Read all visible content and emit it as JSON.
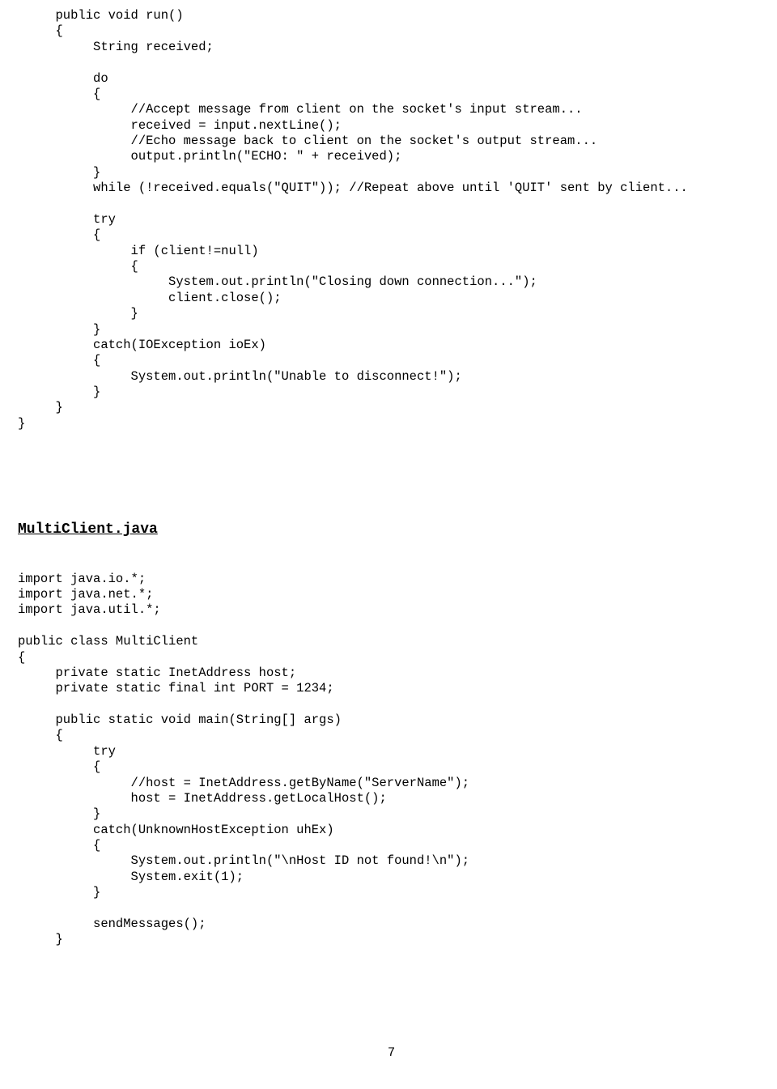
{
  "code_block_1": "     public void run()\n     {\n          String received;\n\n          do\n          {\n               //Accept message from client on the socket's input stream...\n               received = input.nextLine();\n               //Echo message back to client on the socket's output stream...\n               output.println(\"ECHO: \" + received);\n          }\n          while (!received.equals(\"QUIT\")); //Repeat above until 'QUIT' sent by client...\n\n          try\n          {\n               if (client!=null)\n               {\n                    System.out.println(\"Closing down connection...\");\n                    client.close();\n               }\n          }\n          catch(IOException ioEx)\n          {\n               System.out.println(\"Unable to disconnect!\");\n          }\n     }\n}",
  "heading_text": "MultiClient.java",
  "code_block_2": "import java.io.*;\nimport java.net.*;\nimport java.util.*;\n\npublic class MultiClient\n{\n     private static InetAddress host;\n     private static final int PORT = 1234;\n\n     public static void main(String[] args)\n     {\n          try\n          {\n               //host = InetAddress.getByName(\"ServerName\");\n               host = InetAddress.getLocalHost();\n          }\n          catch(UnknownHostException uhEx)\n          {\n               System.out.println(\"\\nHost ID not found!\\n\");\n               System.exit(1);\n          }\n\n          sendMessages();\n     }",
  "page_number": "7"
}
